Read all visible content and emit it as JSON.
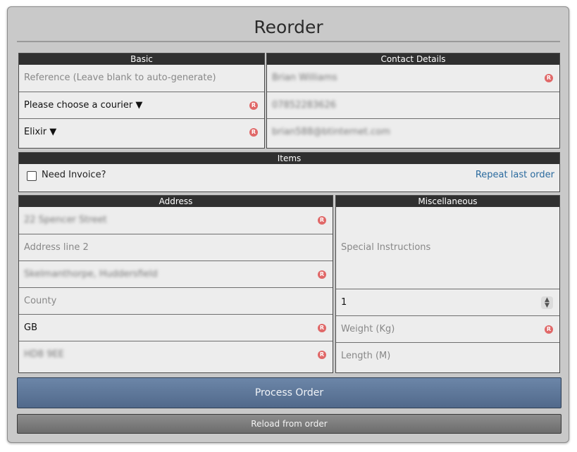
{
  "title": "Reorder",
  "basic": {
    "heading": "Basic",
    "reference_placeholder": "Reference (Leave blank to auto-generate)",
    "courier": "Please choose a courier ▼",
    "service": "Elixir ▼"
  },
  "contact": {
    "heading": "Contact Details",
    "name": "Brian Williams",
    "phone": "07852283626",
    "email": "brian588@btinternet.com"
  },
  "items": {
    "heading": "Items",
    "invoice_label": "Need Invoice?",
    "repeat_link": "Repeat last order"
  },
  "address": {
    "heading": "Address",
    "line1": "22 Spencer Street",
    "line2_placeholder": "Address line 2",
    "town": "Skelmanthorpe, Huddersfield",
    "county_placeholder": "County",
    "country": "GB",
    "postcode": "HD8 9EE"
  },
  "misc": {
    "heading": "Miscellaneous",
    "instructions_placeholder": "Special Instructions",
    "quantity": "1",
    "weight_placeholder": "Weight (Kg)",
    "length_placeholder": "Length (M)"
  },
  "required_marker": "R",
  "buttons": {
    "process": "Process Order",
    "reload": "Reload from order"
  }
}
